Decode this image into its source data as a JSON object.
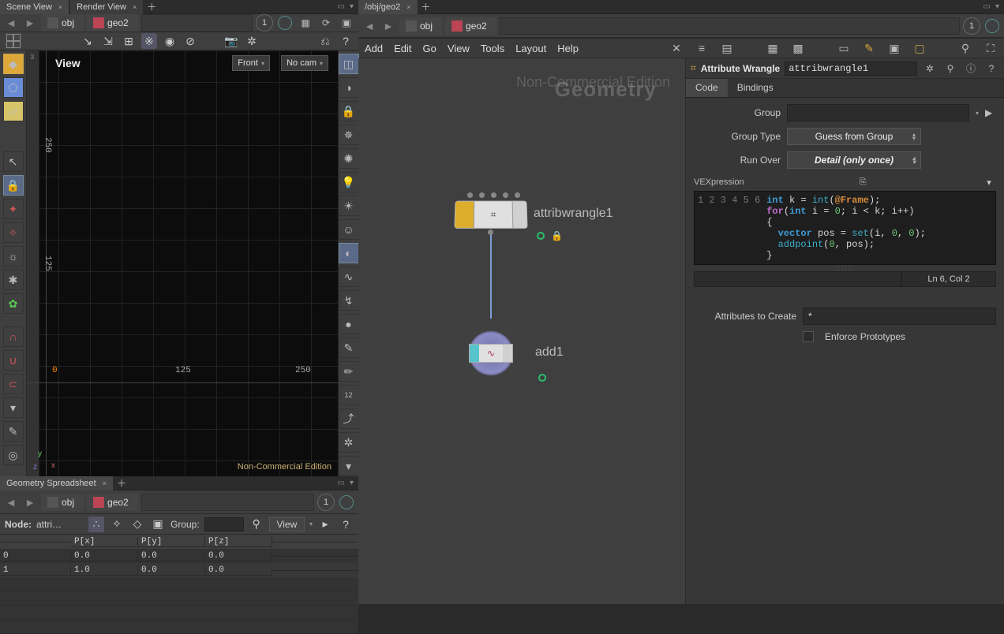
{
  "left": {
    "tabs": [
      "Scene View",
      "Render View"
    ],
    "activeTab": 0,
    "breadcrumb": {
      "seg1": "obj",
      "seg2": "geo2"
    },
    "pin": "1",
    "viewport": {
      "title": "View",
      "frontMenu": "Front",
      "camMenu": "No cam",
      "ncEdition": "Non-Commercial Edition",
      "axis": {
        "x": "x",
        "y": "y",
        "z": "z"
      },
      "ticks": {
        "y1": "250",
        "y2": "125",
        "x0": "0",
        "x1": "125",
        "x2": "250"
      },
      "rulerLabel": "3"
    }
  },
  "spreadsheet": {
    "tab": "Geometry Spreadsheet",
    "breadcrumb": {
      "seg1": "obj",
      "seg2": "geo2"
    },
    "pin": "1",
    "toolbar": {
      "nodeLabel": "Node:",
      "nodePath": "attri…",
      "groupLabel": "Group:",
      "viewBtn": "View"
    },
    "columns": [
      "",
      "P[x]",
      "P[y]",
      "P[z]"
    ],
    "rows": [
      {
        "idx": "0",
        "px": "0.0",
        "py": "0.0",
        "pz": "0.0"
      },
      {
        "idx": "1",
        "px": "1.0",
        "py": "0.0",
        "pz": "0.0"
      }
    ]
  },
  "right": {
    "tabs": [
      "/obj/geo2"
    ],
    "breadcrumb": {
      "seg1": "obj",
      "seg2": "geo2"
    },
    "pin": "1",
    "menu": [
      "Add",
      "Edit",
      "Go",
      "View",
      "Tools",
      "Layout",
      "Help"
    ],
    "watermark": "Geometry",
    "watermark2": "Non-Commercial Edition",
    "nodes": {
      "n1": {
        "label": "attribwrangle1"
      },
      "n2": {
        "label": "add1"
      }
    }
  },
  "params": {
    "type": "Attribute Wrangle",
    "name": "attribwrangle1",
    "tabs": [
      "Code",
      "Bindings"
    ],
    "activeTab": 0,
    "group": {
      "label": "Group",
      "value": ""
    },
    "groupType": {
      "label": "Group Type",
      "value": "Guess from Group"
    },
    "runOver": {
      "label": "Run Over",
      "value": "Detail (only once)"
    },
    "vexLabel": "VEXpression",
    "code": {
      "lines": [
        {
          "n": 1,
          "tokens": [
            [
              "kw",
              "int"
            ],
            [
              "txt",
              " k "
            ],
            [
              "txt",
              "= "
            ],
            [
              "fn",
              "int"
            ],
            [
              "txt",
              "("
            ],
            [
              "attr",
              "@Frame"
            ],
            [
              "txt",
              ");"
            ]
          ]
        },
        {
          "n": 2,
          "tokens": [
            [
              "kw2",
              "for"
            ],
            [
              "txt",
              "("
            ],
            [
              "kw",
              "int"
            ],
            [
              "txt",
              " i "
            ],
            [
              "txt",
              "= "
            ],
            [
              "num",
              "0"
            ],
            [
              "txt",
              "; i < k; i++"
            ],
            [
              "txt",
              ")"
            ]
          ]
        },
        {
          "n": 3,
          "tokens": [
            [
              "txt",
              "{"
            ]
          ]
        },
        {
          "n": 4,
          "tokens": [
            [
              "txt",
              "  "
            ],
            [
              "kw",
              "vector"
            ],
            [
              "txt",
              " pos "
            ],
            [
              "txt",
              "= "
            ],
            [
              "fn",
              "set"
            ],
            [
              "txt",
              "(i, "
            ],
            [
              "num",
              "0"
            ],
            [
              "txt",
              ", "
            ],
            [
              "num",
              "0"
            ],
            [
              "txt",
              ");"
            ]
          ]
        },
        {
          "n": 5,
          "tokens": [
            [
              "txt",
              "  "
            ],
            [
              "fn",
              "addpoint"
            ],
            [
              "txt",
              "("
            ],
            [
              "num",
              "0"
            ],
            [
              "txt",
              ", pos"
            ],
            [
              "txt",
              ");"
            ]
          ]
        },
        {
          "n": 6,
          "tokens": [
            [
              "txt",
              "}"
            ]
          ]
        }
      ]
    },
    "cursor": "Ln 6, Col 2",
    "attrsCreate": {
      "label": "Attributes to Create",
      "value": "*"
    },
    "enforce": {
      "label": "Enforce Prototypes"
    }
  }
}
